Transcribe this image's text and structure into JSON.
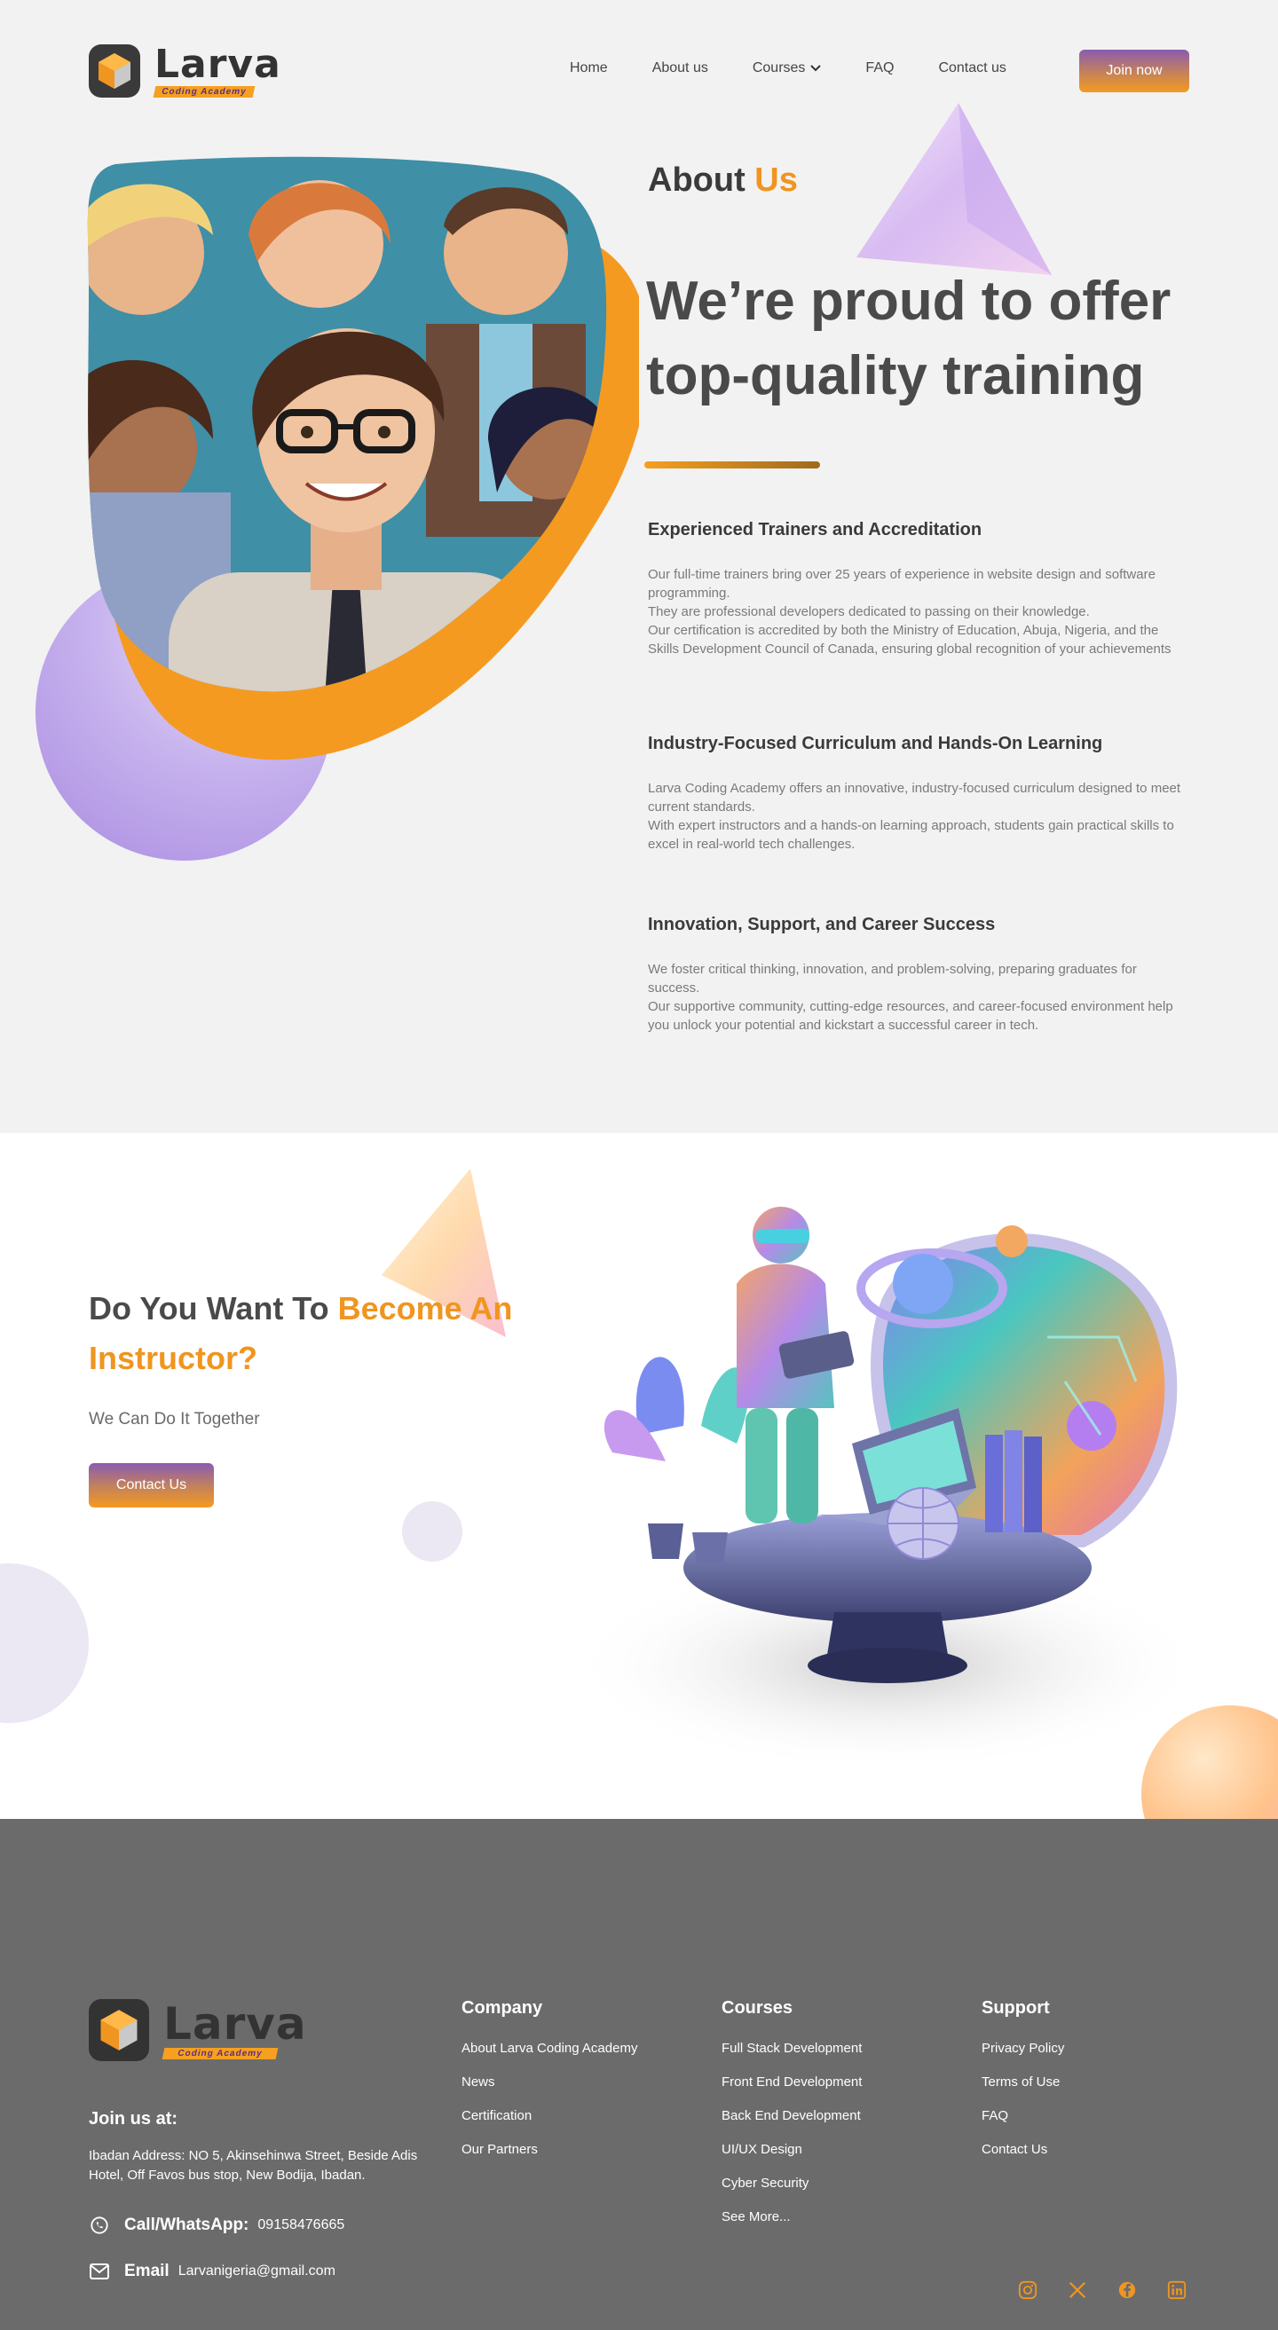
{
  "brand": {
    "name": "Larva",
    "tagline": "Coding Academy"
  },
  "nav": {
    "items": [
      "Home",
      "About us",
      "Courses",
      "FAQ",
      "Contact us"
    ],
    "cta": "Join now"
  },
  "about": {
    "title_main": "About",
    "title_accent": "Us",
    "headline": "We’re proud to offer top-quality training",
    "features": [
      {
        "title": "Experienced Trainers and Accreditation",
        "body": "Our full-time trainers bring over 25 years of experience in website design and software programming.\nThey are professional developers dedicated to passing on their knowledge.\nOur certification is accredited by both the Ministry of Education, Abuja, Nigeria, and the Skills Development Council of Canada, ensuring global recognition of your achievements"
      },
      {
        "title": "Industry-Focused Curriculum and Hands-On Learning",
        "body": "Larva Coding Academy offers an innovative, industry-focused curriculum designed to meet current standards.\nWith expert instructors and a hands-on learning approach, students gain practical skills to excel in real-world tech challenges."
      },
      {
        "title": "Innovation, Support, and Career Success",
        "body": "We foster critical thinking, innovation, and problem-solving, preparing graduates for success.\nOur supportive community, cutting-edge resources, and career-focused environment help you unlock your potential and kickstart a successful career in tech."
      }
    ]
  },
  "instructor": {
    "title_main": "Do  You Want To",
    "title_accent": "Become An Instructor?",
    "subtitle": "We Can Do It Together",
    "cta": "Contact Us"
  },
  "footer": {
    "join_title": "Join us at:",
    "address": "Ibadan Address: NO 5, Akinsehinwa Street, Beside Adis Hotel, Off Favos bus stop, New Bodija, Ibadan.",
    "phone_label": "Call/WhatsApp:",
    "phone": "09158476665",
    "email_label": "Email",
    "email": "Larvanigeria@gmail.com",
    "company": {
      "title": "Company",
      "items": [
        "About Larva Coding Academy",
        "News",
        "Certification",
        "Our Partners"
      ]
    },
    "courses": {
      "title": "Courses",
      "items": [
        "Full Stack Development",
        "Front End Development",
        "Back End Development",
        "UI/UX Design",
        "Cyber Security",
        "See More..."
      ]
    },
    "support": {
      "title": "Support",
      "items": [
        "Privacy Policy",
        "Terms of Use",
        "FAQ",
        "Contact Us"
      ]
    },
    "socials": [
      "instagram-icon",
      "x-icon",
      "facebook-icon",
      "linkedin-icon"
    ]
  },
  "colors": {
    "accent": "#f0951f",
    "heading": "#4a4a4a",
    "footer_bg": "#6b6b6b",
    "button_gradient": [
      "#8a5bb0",
      "#f59a20"
    ]
  }
}
